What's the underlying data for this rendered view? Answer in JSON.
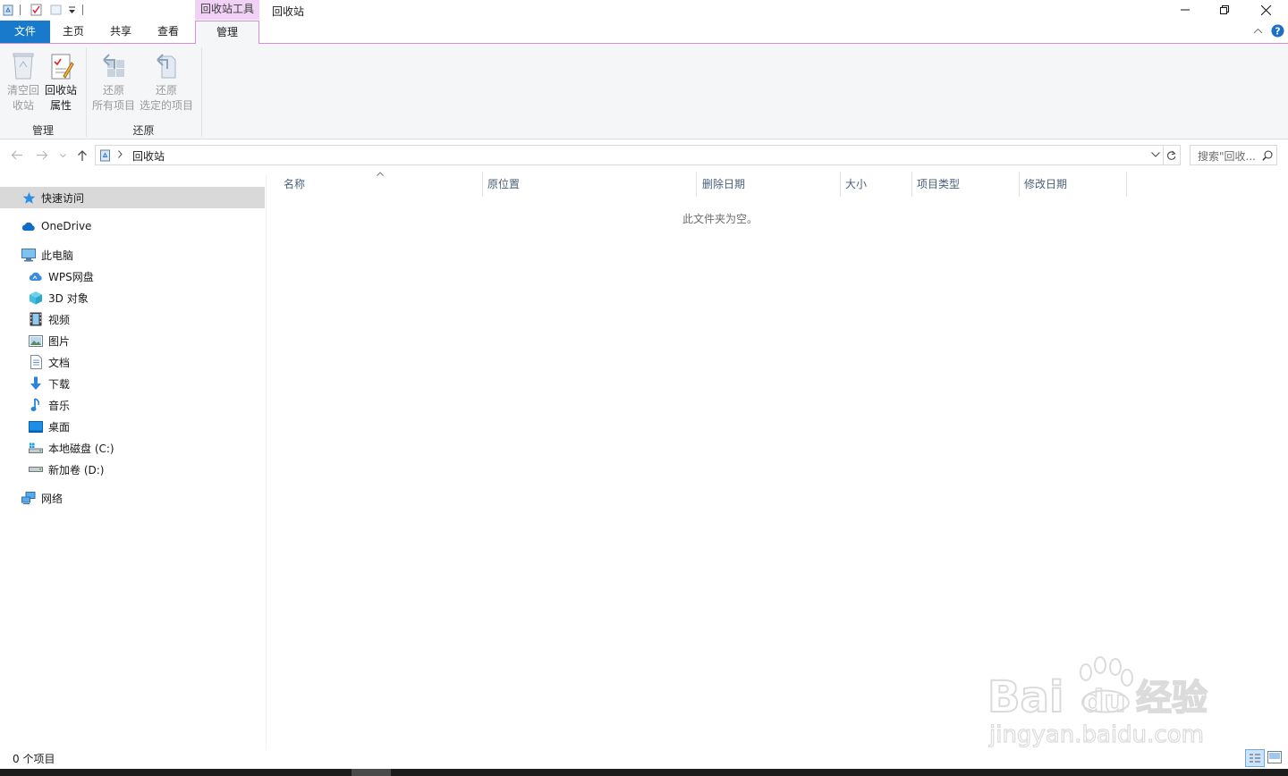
{
  "window": {
    "title": "回收站",
    "context_tab_group": "回收站工具"
  },
  "ribbon": {
    "tabs": [
      {
        "label": "文件"
      },
      {
        "label": "主页"
      },
      {
        "label": "共享"
      },
      {
        "label": "查看"
      },
      {
        "label": "管理"
      }
    ],
    "groups": {
      "manage": {
        "label": "管理",
        "empty_bin": {
          "line1": "清空回",
          "line2": "收站"
        },
        "bin_props": {
          "line1": "回收站",
          "line2": "属性"
        }
      },
      "restore": {
        "label": "还原",
        "restore_all": {
          "line1": "还原",
          "line2": "所有项目"
        },
        "restore_selected": {
          "line1": "还原",
          "line2": "选定的项目"
        }
      }
    }
  },
  "address": {
    "path": "回收站",
    "search_placeholder": "搜索\"回收..."
  },
  "navpane": {
    "quick_access": "快速访问",
    "onedrive": "OneDrive",
    "this_pc": "此电脑",
    "pc_items": [
      {
        "label": "WPS网盘",
        "icon": "cloud-icon"
      },
      {
        "label": "3D 对象",
        "icon": "cube-icon"
      },
      {
        "label": "视频",
        "icon": "video-icon"
      },
      {
        "label": "图片",
        "icon": "picture-icon"
      },
      {
        "label": "文档",
        "icon": "document-icon"
      },
      {
        "label": "下载",
        "icon": "download-icon"
      },
      {
        "label": "音乐",
        "icon": "music-icon"
      },
      {
        "label": "桌面",
        "icon": "desktop-icon"
      },
      {
        "label": "本地磁盘 (C:)",
        "icon": "drive-c-icon"
      },
      {
        "label": "新加卷 (D:)",
        "icon": "drive-icon"
      }
    ],
    "network": "网络"
  },
  "columns": [
    {
      "label": "名称"
    },
    {
      "label": "原位置"
    },
    {
      "label": "删除日期"
    },
    {
      "label": "大小"
    },
    {
      "label": "项目类型"
    },
    {
      "label": "修改日期"
    }
  ],
  "empty_message": "此文件夹为空。",
  "status": {
    "item_count": "0 个项目"
  },
  "watermark": {
    "brand": "Bai",
    "brand2": "du",
    "cn": "经验",
    "url": "jingyan.baidu.com"
  },
  "colors": {
    "accent": "#1979ca",
    "context_tab": "#f0d2f5",
    "selected_nav": "#d9d9d9"
  }
}
